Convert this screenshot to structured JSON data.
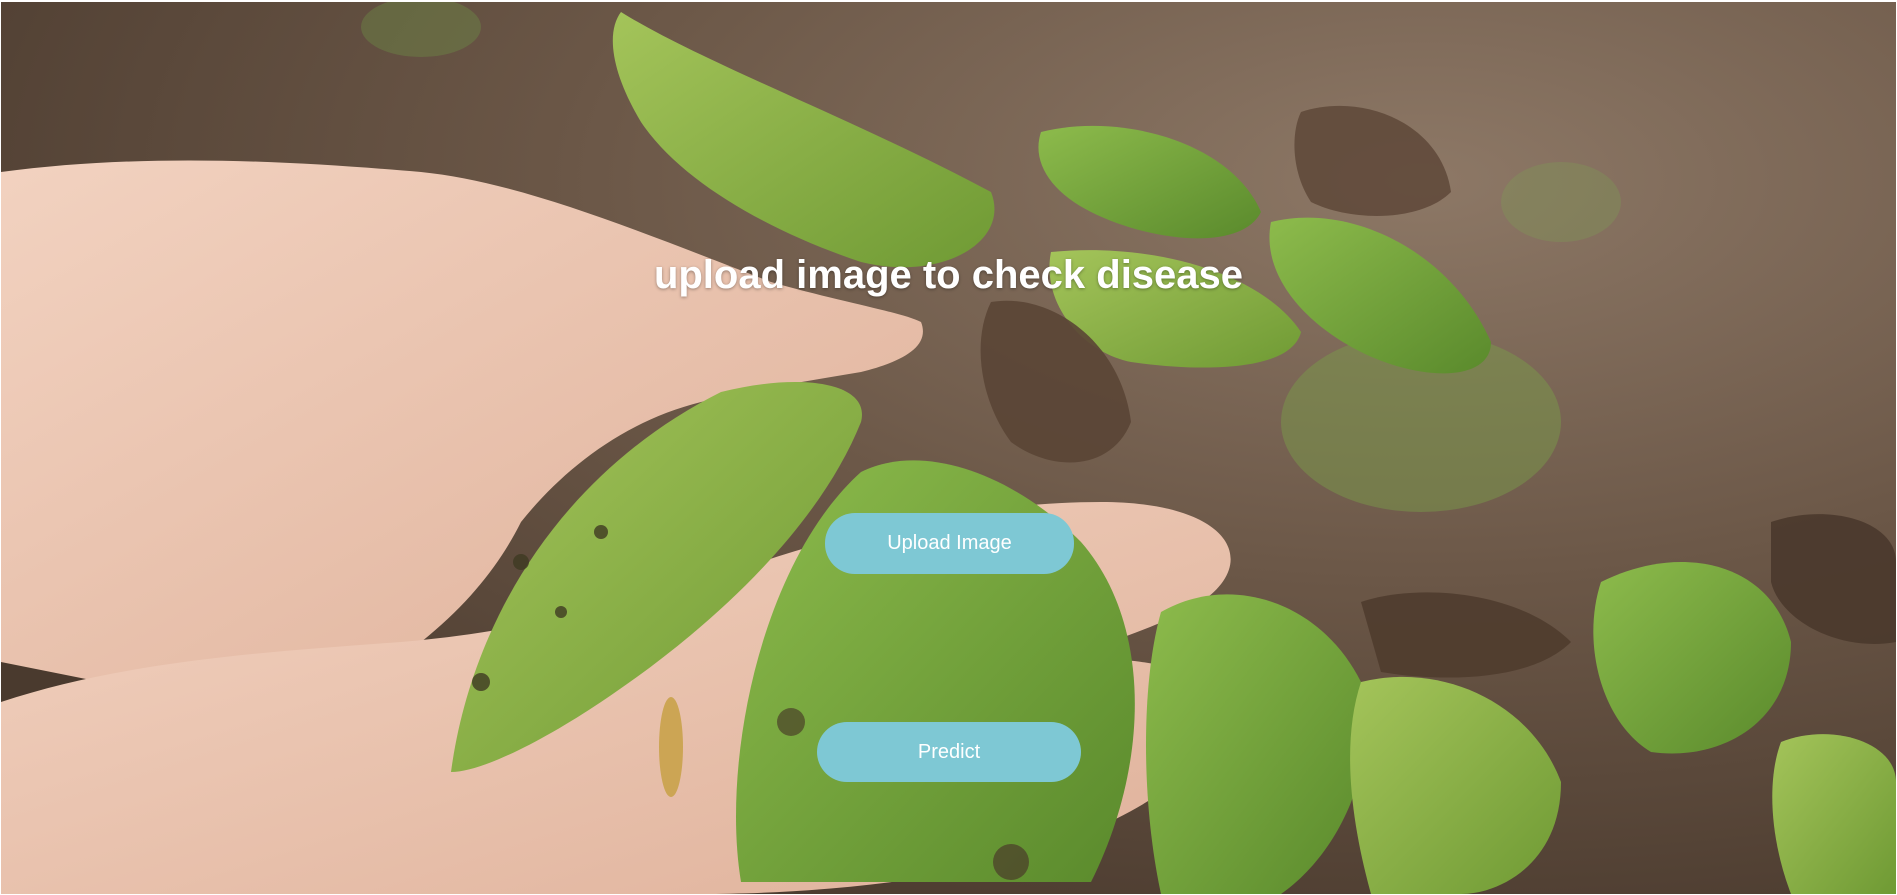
{
  "hero": {
    "title": "upload image to check disease",
    "image": "background-photo-hands-holding-diseased-potato-leaves"
  },
  "actions": {
    "upload_label": "Upload Image",
    "predict_label": "Predict"
  },
  "colors": {
    "button_bg": "#7ec8d4",
    "button_text": "#ffffff",
    "title_text": "#ffffff"
  }
}
